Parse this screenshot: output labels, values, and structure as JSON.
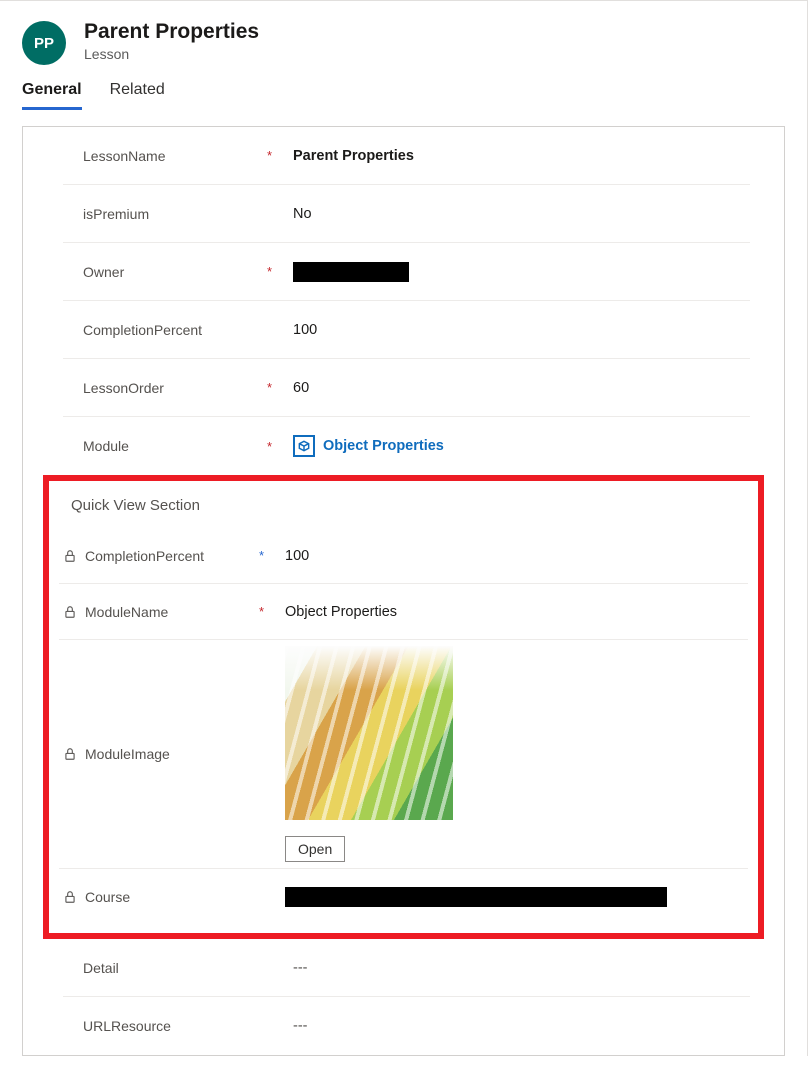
{
  "header": {
    "avatar_initials": "PP",
    "title": "Parent Properties",
    "subtitle": "Lesson"
  },
  "tabs": [
    {
      "label": "General",
      "active": true
    },
    {
      "label": "Related",
      "active": false
    }
  ],
  "fields": {
    "lesson_name": {
      "label": "LessonName",
      "value": "Parent Properties",
      "required_mark": "*"
    },
    "is_premium": {
      "label": "isPremium",
      "value": "No",
      "required_mark": ""
    },
    "owner": {
      "label": "Owner",
      "value": "",
      "required_mark": "*"
    },
    "completion_percent": {
      "label": "CompletionPercent",
      "value": "100",
      "required_mark": ""
    },
    "lesson_order": {
      "label": "LessonOrder",
      "value": "60",
      "required_mark": "*"
    },
    "module": {
      "label": "Module",
      "value": "Object Properties",
      "required_mark": "*"
    },
    "detail": {
      "label": "Detail",
      "value": "---",
      "required_mark": ""
    },
    "url_resource": {
      "label": "URLResource",
      "value": "---",
      "required_mark": ""
    }
  },
  "quickview": {
    "title": "Quick View Section",
    "fields": {
      "completion_percent": {
        "label": "CompletionPercent",
        "value": "100",
        "mark": "*",
        "mark_style": "blue"
      },
      "module_name": {
        "label": "ModuleName",
        "value": "Object Properties",
        "mark": "*",
        "mark_style": "red"
      },
      "module_image": {
        "label": "ModuleImage",
        "open_label": "Open"
      },
      "course": {
        "label": "Course",
        "value": ""
      }
    }
  }
}
